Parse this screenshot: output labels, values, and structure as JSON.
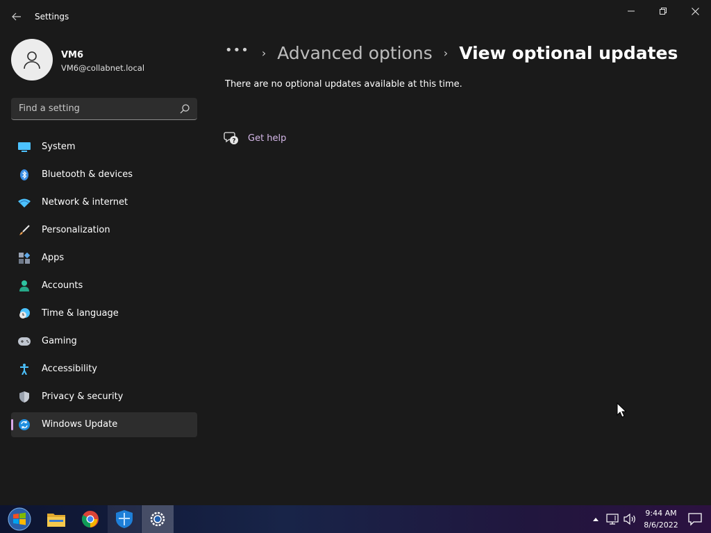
{
  "window": {
    "title": "Settings"
  },
  "profile": {
    "name": "VM6",
    "email": "VM6@collabnet.local"
  },
  "search": {
    "placeholder": "Find a setting"
  },
  "sidebar": {
    "items": [
      {
        "label": "System",
        "icon": "system-icon"
      },
      {
        "label": "Bluetooth & devices",
        "icon": "bluetooth-icon"
      },
      {
        "label": "Network & internet",
        "icon": "wifi-icon"
      },
      {
        "label": "Personalization",
        "icon": "brush-icon"
      },
      {
        "label": "Apps",
        "icon": "apps-icon"
      },
      {
        "label": "Accounts",
        "icon": "person-icon"
      },
      {
        "label": "Time & language",
        "icon": "clock-globe-icon"
      },
      {
        "label": "Gaming",
        "icon": "gamepad-icon"
      },
      {
        "label": "Accessibility",
        "icon": "accessibility-icon"
      },
      {
        "label": "Privacy & security",
        "icon": "shield-icon"
      },
      {
        "label": "Windows Update",
        "icon": "update-icon",
        "active": true
      }
    ]
  },
  "breadcrumb": {
    "more": "•••",
    "separator": "›",
    "parent": "Advanced options",
    "current": "View optional updates"
  },
  "main": {
    "message": "There are no optional updates available at this time.",
    "help_link": "Get help"
  },
  "taskbar": {
    "apps": [
      "start-icon",
      "file-explorer-icon",
      "chrome-icon",
      "windows-security-icon",
      "settings-icon"
    ],
    "time": "9:44 AM",
    "date": "8/6/2022"
  },
  "colors": {
    "background": "#1a1a1a",
    "accent": "#d9a8e8",
    "link": "#d5b8e8",
    "active_item": "#2d2d2d"
  }
}
